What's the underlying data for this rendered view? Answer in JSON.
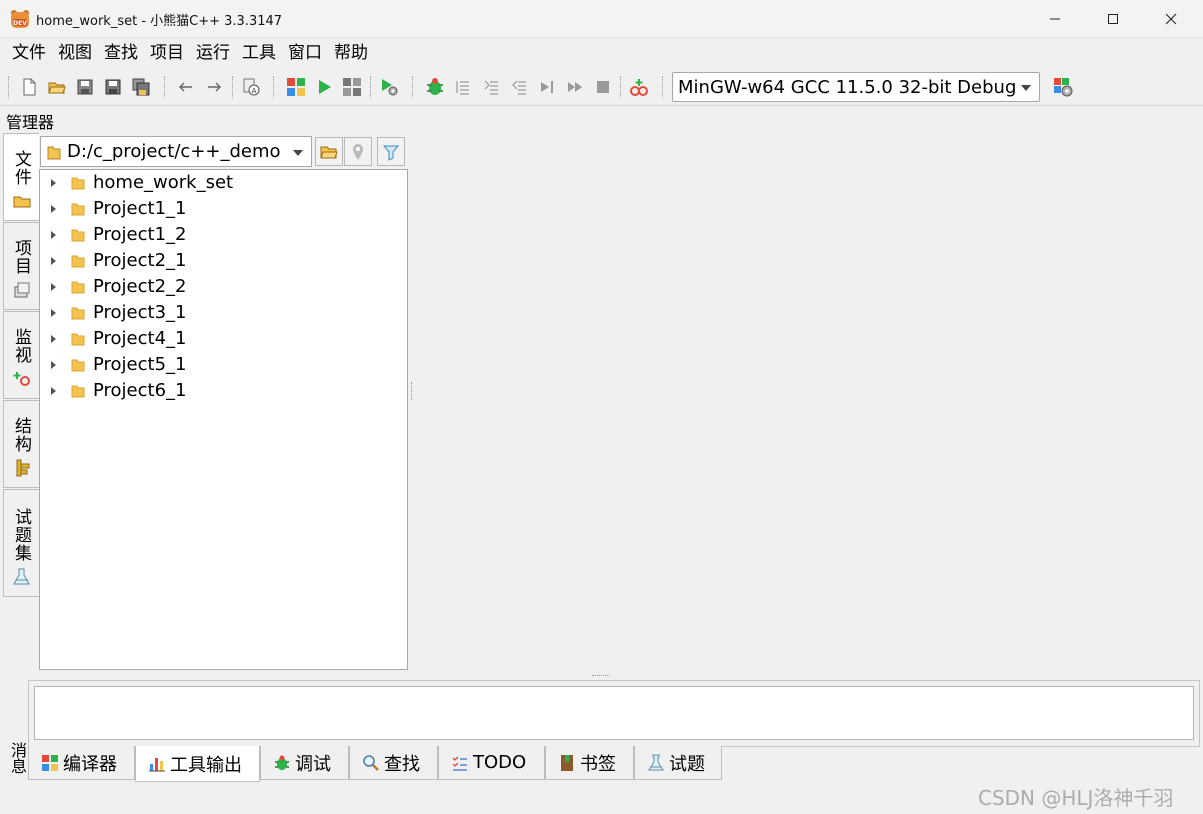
{
  "window": {
    "title": "home_work_set - 小熊猫C++ 3.3.3147",
    "app_icon": "dev-bear-icon",
    "icon_text": "DEV"
  },
  "menu": [
    "文件",
    "视图",
    "查找",
    "项目",
    "运行",
    "工具",
    "窗口",
    "帮助"
  ],
  "toolbar": {
    "compiler": "MinGW-w64 GCC 11.5.0 32-bit Debug"
  },
  "manager": {
    "title": "管理器",
    "side_tabs": [
      {
        "label": "文件",
        "icon": "folder-icon",
        "active": true
      },
      {
        "label": "项目",
        "icon": "project-icon",
        "active": false
      },
      {
        "label": "监视",
        "icon": "watch-icon",
        "active": false
      },
      {
        "label": "结构",
        "icon": "structure-icon",
        "active": false
      },
      {
        "label": "试题集",
        "icon": "problem-set-icon",
        "active": false
      }
    ],
    "path": "D:/c_project/c++_demo",
    "tree": [
      "home_work_set",
      "Project1_1",
      "Project1_2",
      "Project2_1",
      "Project2_2",
      "Project3_1",
      "Project4_1",
      "Project5_1",
      "Project6_1"
    ]
  },
  "messages": {
    "label": "消息",
    "tabs": [
      {
        "label": "编译器",
        "icon": "compiler-icon",
        "active": false
      },
      {
        "label": "工具输出",
        "icon": "chart-icon",
        "active": true
      },
      {
        "label": "调试",
        "icon": "debug-bug-icon",
        "active": false
      },
      {
        "label": "查找",
        "icon": "search-icon",
        "active": false
      },
      {
        "label": "TODO",
        "icon": "todo-icon",
        "active": false
      },
      {
        "label": "书签",
        "icon": "bookmark-icon",
        "active": false
      },
      {
        "label": "试题",
        "icon": "flask-icon",
        "active": false
      }
    ]
  },
  "watermark": "CSDN @HLJ洛神千羽",
  "colors": {
    "green": "#2db34a",
    "folder": "#f4c34f",
    "accent_blue": "#3a8ee6",
    "red": "#e24a3b"
  }
}
